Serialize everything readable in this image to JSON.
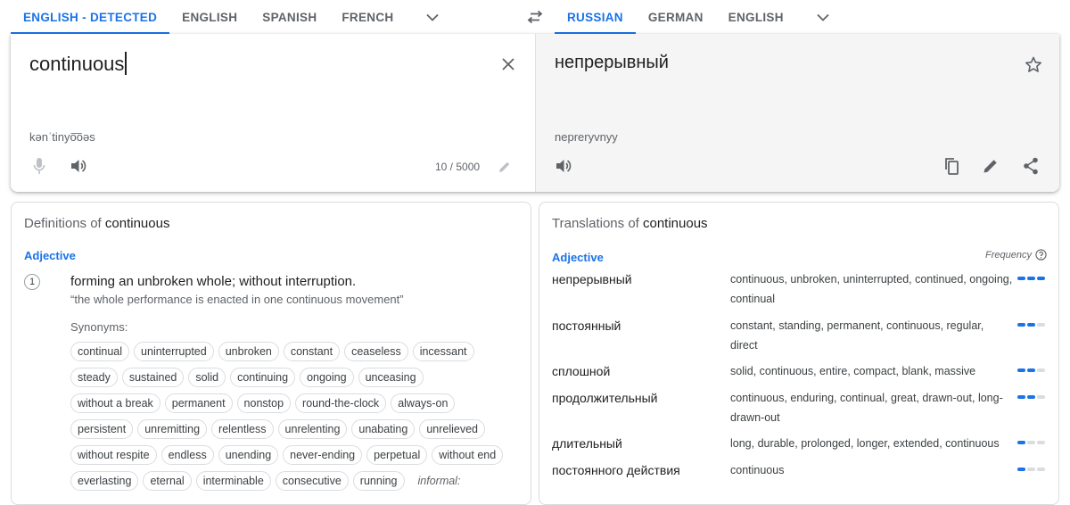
{
  "source_languages": {
    "tabs": [
      {
        "label": "ENGLISH - DETECTED",
        "active": true
      },
      {
        "label": "ENGLISH",
        "active": false
      },
      {
        "label": "SPANISH",
        "active": false
      },
      {
        "label": "FRENCH",
        "active": false
      }
    ]
  },
  "target_languages": {
    "tabs": [
      {
        "label": "RUSSIAN",
        "active": true
      },
      {
        "label": "GERMAN",
        "active": false
      },
      {
        "label": "ENGLISH",
        "active": false
      }
    ]
  },
  "source": {
    "text": "continuous",
    "phonetic": "kənˈtinyo͞oəs",
    "char_count": "10 / 5000"
  },
  "target": {
    "text": "непрерывный",
    "transliteration": "nepreryvnyy"
  },
  "definitions": {
    "heading_prefix": "Definitions of",
    "heading_word": "continuous",
    "part_of_speech": "Adjective",
    "items": [
      {
        "number": "1",
        "text": "forming an unbroken whole; without interruption.",
        "example": "“the whole performance is enacted in one continuous movement”",
        "synonyms_label": "Synonyms:",
        "synonyms": [
          "continual",
          "uninterrupted",
          "unbroken",
          "constant",
          "ceaseless",
          "incessant",
          "steady",
          "sustained",
          "solid",
          "continuing",
          "ongoing",
          "unceasing",
          "without a break",
          "permanent",
          "nonstop",
          "round-the-clock",
          "always-on",
          "persistent",
          "unremitting",
          "relentless",
          "unrelenting",
          "unabating",
          "unrelieved",
          "without respite",
          "endless",
          "unending",
          "never-ending",
          "perpetual",
          "without end",
          "everlasting",
          "eternal",
          "interminable",
          "consecutive",
          "running"
        ],
        "informal_label": "informal:"
      }
    ]
  },
  "translations": {
    "heading_prefix": "Translations of",
    "heading_word": "continuous",
    "part_of_speech": "Adjective",
    "frequency_label": "Frequency",
    "rows": [
      {
        "word": "непрерывный",
        "synonyms": "continuous, unbroken, uninterrupted, continued, ongoing, continual",
        "frequency": 3
      },
      {
        "word": "постоянный",
        "synonyms": "constant, standing, permanent, continuous, regular, direct",
        "frequency": 2
      },
      {
        "word": "сплошной",
        "synonyms": "solid, continuous, entire, compact, blank, massive",
        "frequency": 2
      },
      {
        "word": "продолжительный",
        "synonyms": "continuous, enduring, continual, great, drawn-out, long-drawn-out",
        "frequency": 2
      },
      {
        "word": "длительный",
        "synonyms": "long, durable, prolonged, longer, extended, continuous",
        "frequency": 1
      },
      {
        "word": "постоянного действия",
        "synonyms": "continuous",
        "frequency": 1
      }
    ]
  },
  "colors": {
    "accent": "#1a73e8",
    "muted": "#5f6368",
    "target_bg": "#f5f5f5"
  }
}
